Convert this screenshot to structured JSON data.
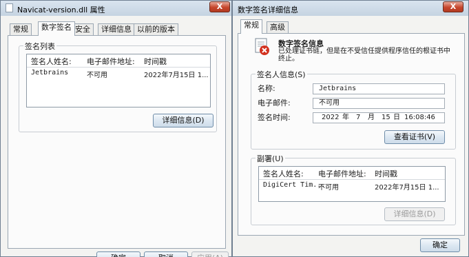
{
  "left_window": {
    "title": "Navicat-version.dll 属性",
    "close_label": "X",
    "tabs": [
      "常规",
      "数字签名",
      "安全",
      "详细信息",
      "以前的版本"
    ],
    "signature_list": {
      "group_title": "签名列表",
      "columns": [
        "签名人姓名:",
        "电子邮件地址:",
        "时间戳"
      ],
      "rows": [
        {
          "name": "Jetbrains",
          "email": "不可用",
          "timestamp": "2022年7月15日 1..."
        }
      ]
    },
    "details_button": "详细信息(D)",
    "footer_buttons": [
      "确定",
      "取消",
      "应用(A)"
    ]
  },
  "right_window": {
    "title": "数字签名详细信息",
    "close_label": "X",
    "tabs": [
      "常规",
      "高级"
    ],
    "info_heading": "数字签名信息",
    "info_text": "已处理证书链，但是在不受信任提供程序信任的根证书中终止。",
    "signer_group": {
      "title": "签名人信息(S)",
      "name_label": "名称:",
      "name_value": "Jetbrains",
      "email_label": "电子邮件:",
      "email_value": "不可用",
      "time_label": "签名时间:",
      "time_value": {
        "year": "2022",
        "y": "年",
        "month": "7",
        "m": "月",
        "day": "15",
        "d": "日",
        "time": "16:08:46"
      }
    },
    "view_cert_button": "查看证书(V)",
    "countersign_group": {
      "title": "副署(U)",
      "columns": [
        "签名人姓名:",
        "电子邮件地址:",
        "时间戳"
      ],
      "rows": [
        {
          "name": "DigiCert Tim...",
          "email": "不可用",
          "timestamp": "2022年7月15日 1..."
        }
      ]
    },
    "details_button": "详细信息(D)",
    "ok_button": "确定"
  },
  "colors": {
    "titlebar": "#c5d3e1",
    "close": "#c6462c",
    "window_bg": "#f3f3f1"
  }
}
